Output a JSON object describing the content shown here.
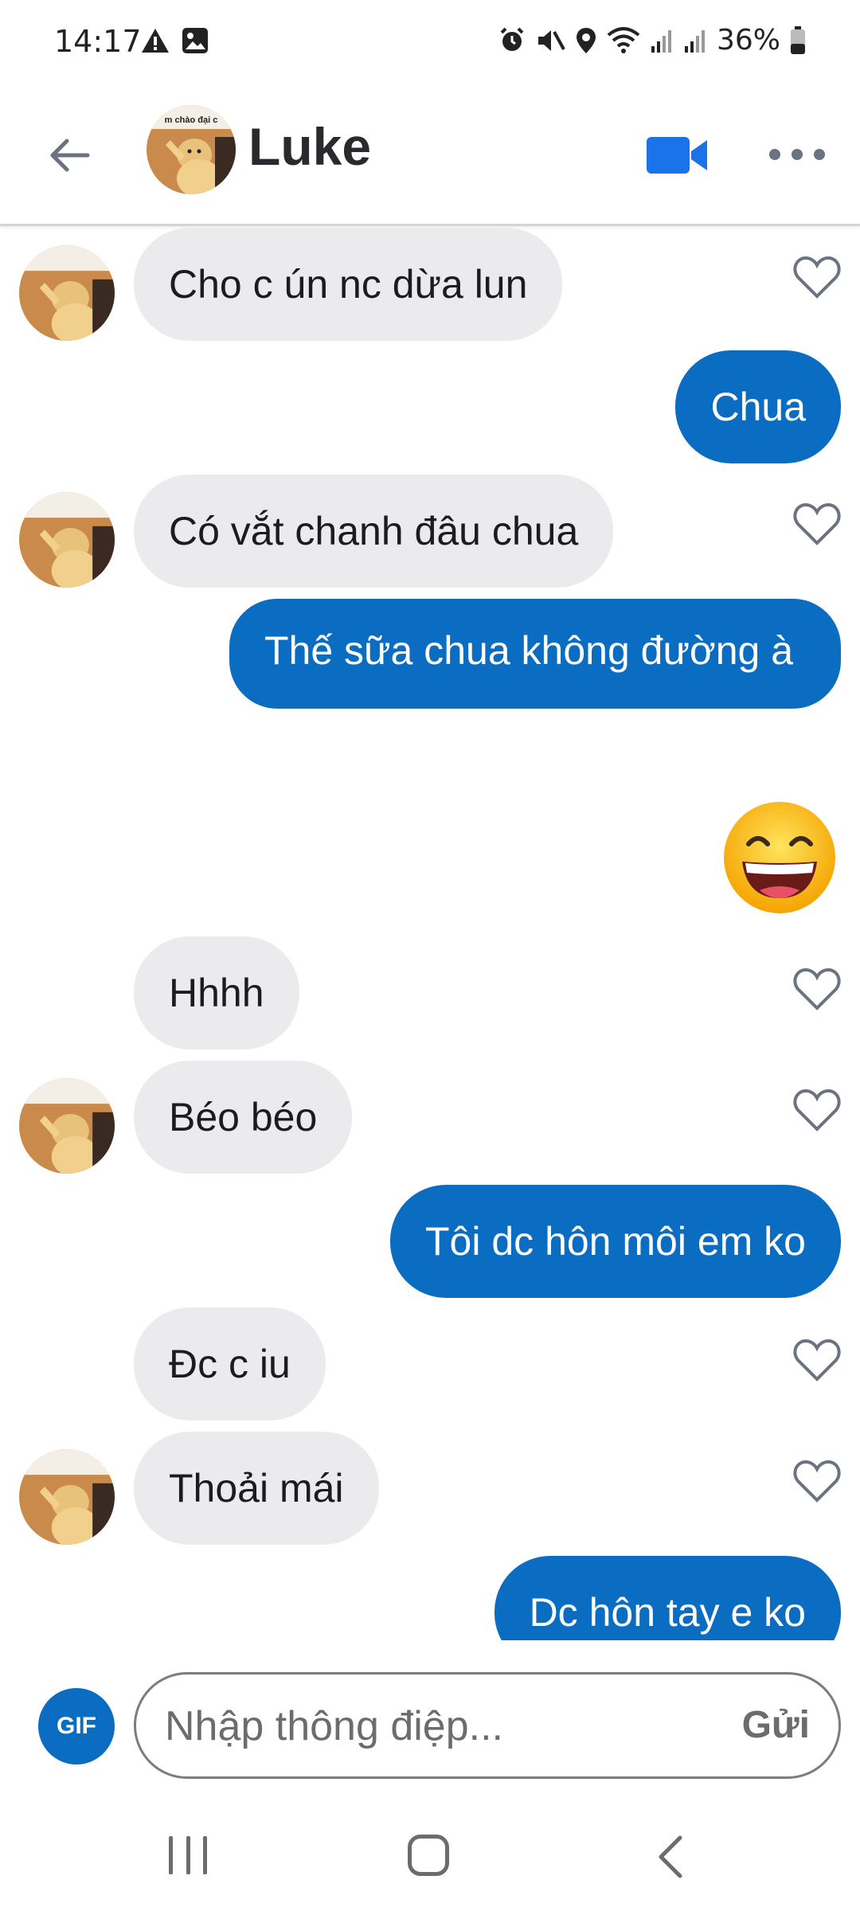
{
  "status_bar": {
    "time": "14:17",
    "battery": "36%",
    "icons": [
      "warning-icon",
      "image-icon",
      "alarm-icon",
      "mute-icon",
      "location-icon",
      "wifi-icon",
      "signal-icon",
      "signal-icon",
      "battery-icon"
    ]
  },
  "header": {
    "name": "Luke",
    "avatar_caption": "m chào đại c"
  },
  "messages": [
    {
      "side": "in",
      "text": "Cho c ún nc dừa lun",
      "avatar": true
    },
    {
      "side": "out",
      "text": "Chua"
    },
    {
      "side": "in",
      "text": "Có vắt chanh đâu chua",
      "avatar": true
    },
    {
      "side": "out",
      "text": "Thế sữa chua không đường à"
    },
    {
      "side": "out",
      "emoji": "grinning-face-emoji"
    },
    {
      "side": "in",
      "text": "Hhhh",
      "avatar": false
    },
    {
      "side": "in",
      "text": "Béo béo",
      "avatar": true
    },
    {
      "side": "out",
      "text": "Tôi dc hôn môi em ko"
    },
    {
      "side": "in",
      "text": "Đc c iu",
      "avatar": false
    },
    {
      "side": "in",
      "text": "Thoải mái",
      "avatar": true
    },
    {
      "side": "out",
      "text": "Dc hôn tay e ko"
    }
  ],
  "composer": {
    "gif_label": "GIF",
    "placeholder": "Nhập thông điệp...",
    "send_label": "Gửi"
  },
  "colors": {
    "accent": "#0a6dc2",
    "incoming_bubble": "#ebebee"
  }
}
